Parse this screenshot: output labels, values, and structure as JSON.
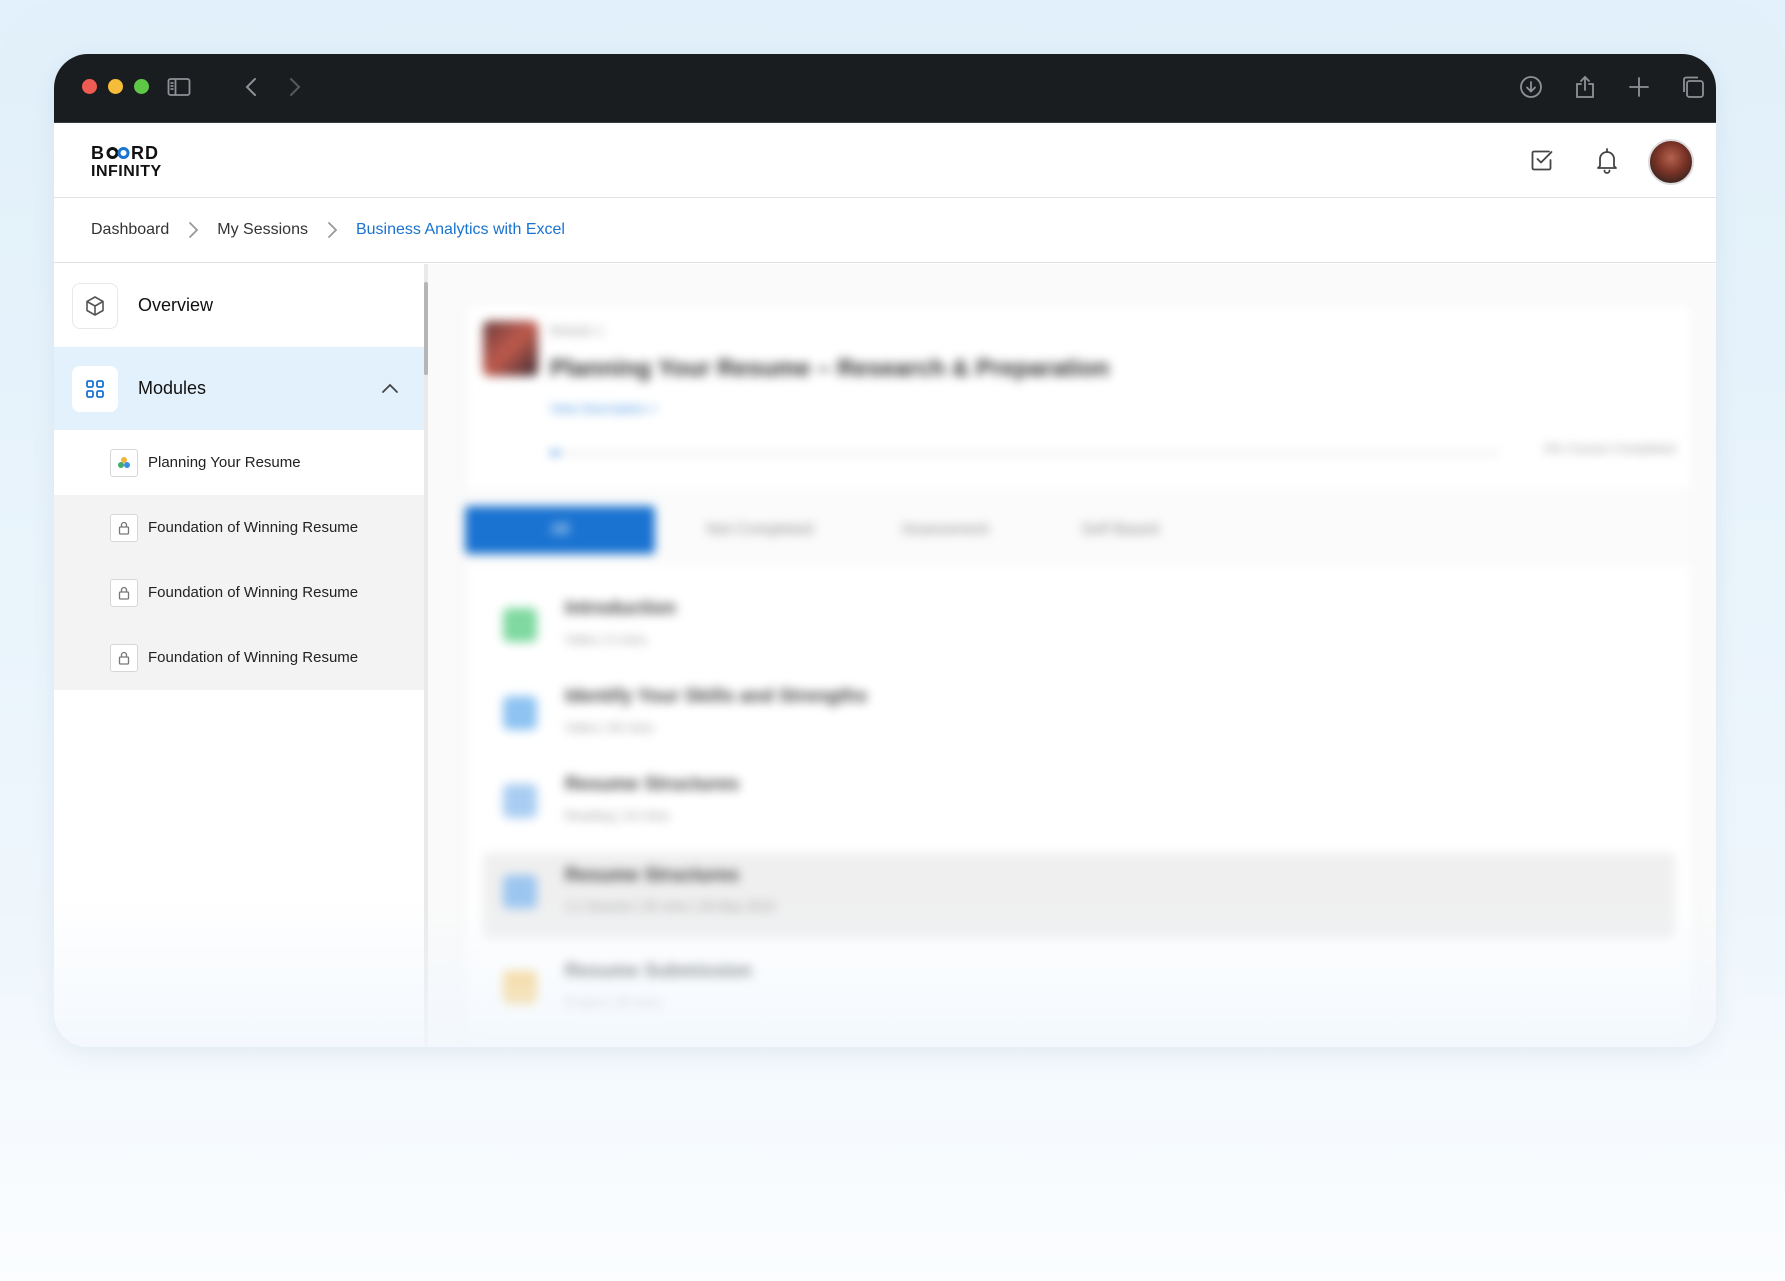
{
  "header": {
    "logo_line1_left": "B",
    "logo_line1_right": "RD",
    "logo_line2": "INFINITY"
  },
  "breadcrumb": {
    "items": [
      "Dashboard",
      "My Sessions",
      "Business Analytics with Excel"
    ]
  },
  "sidebar": {
    "overview_label": "Overview",
    "modules_label": "Modules",
    "modules": [
      {
        "label": "Planning Your Resume",
        "state": "current"
      },
      {
        "label": "Foundation of Winning Resume",
        "state": "locked"
      },
      {
        "label": "Foundation of Winning Resume",
        "state": "locked"
      },
      {
        "label": "Foundation of Winning Resume",
        "state": "locked"
      }
    ]
  },
  "main": {
    "module_tag": "Module 1",
    "module_title": "Planning Your Resume – Research & Preparation",
    "view_description": "View Description  >",
    "progress_percent": 0,
    "progress_text": "0% Course Completed",
    "tabs": [
      "All",
      "Not Completed",
      "Assessment",
      "Self Based"
    ],
    "lessons": [
      {
        "title": "Introduction",
        "meta": "Video  |  5 mins",
        "color": "#7fd9a0"
      },
      {
        "title": "Identify Your Skills and Strengths",
        "meta": "Video  |  30 mins",
        "color": "#8ec3f2"
      },
      {
        "title": "Resume Structures",
        "meta": "Reading  |  10 mins",
        "color": "#a9cdf2"
      },
      {
        "title": "Resume Structures",
        "meta": "1:1 Session  |  30 mins  |  28 May 2023",
        "color": "#9cc6f0"
      },
      {
        "title": "Resume Submission",
        "meta": "Project  |  30 mins",
        "color": "#f7c96b"
      }
    ]
  },
  "colors": {
    "accent": "#1a73d1",
    "chrome": "#1a1d20",
    "sidebar_active": "#e3f1fc"
  },
  "icons": {
    "chrome_left": [
      "sidebar-toggle-icon",
      "back-icon",
      "forward-icon"
    ],
    "chrome_right": [
      "download-icon",
      "share-icon",
      "new-tab-icon",
      "tabs-icon"
    ],
    "header": [
      "tasks-icon",
      "bell-icon"
    ]
  }
}
